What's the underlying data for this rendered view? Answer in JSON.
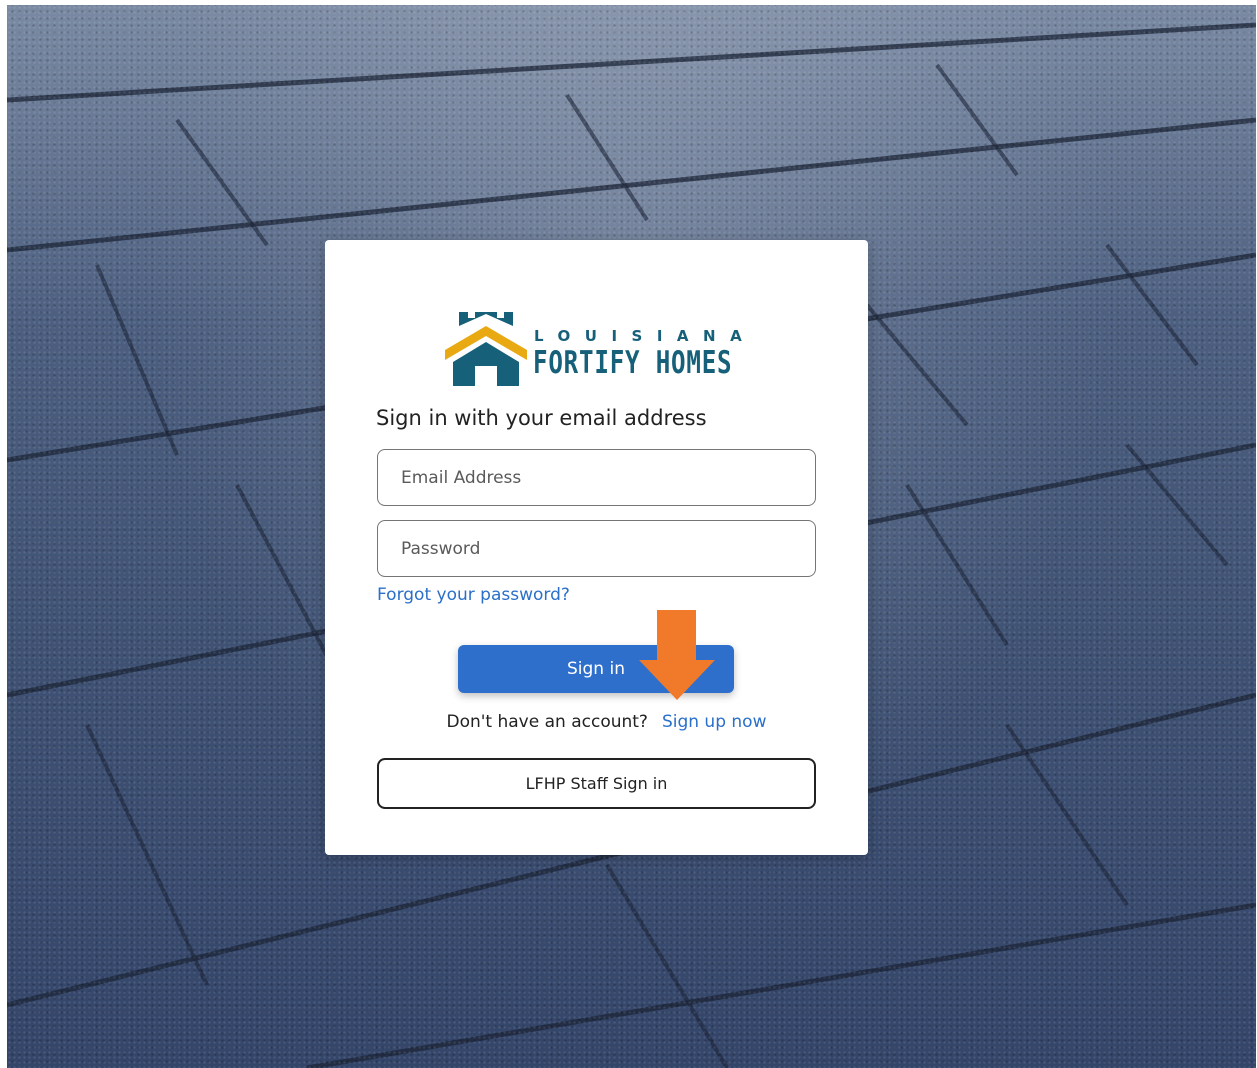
{
  "brand": {
    "logo_top": "LOUISIANA",
    "logo_bottom": "FORTIFY HOMES",
    "colors": {
      "teal": "#17607a",
      "gold": "#e8a912"
    }
  },
  "form": {
    "heading": "Sign in with your email address",
    "email_placeholder": "Email Address",
    "password_placeholder": "Password",
    "forgot_link": "Forgot your password?",
    "signin_label": "Sign in",
    "no_account_text": "Don't have an account?",
    "signup_link": "Sign up now",
    "staff_signin_label": "LFHP Staff Sign in"
  },
  "colors": {
    "primary_button": "#2f6fcc",
    "link": "#2a6fc9",
    "annotation_arrow": "#f07a2a"
  }
}
